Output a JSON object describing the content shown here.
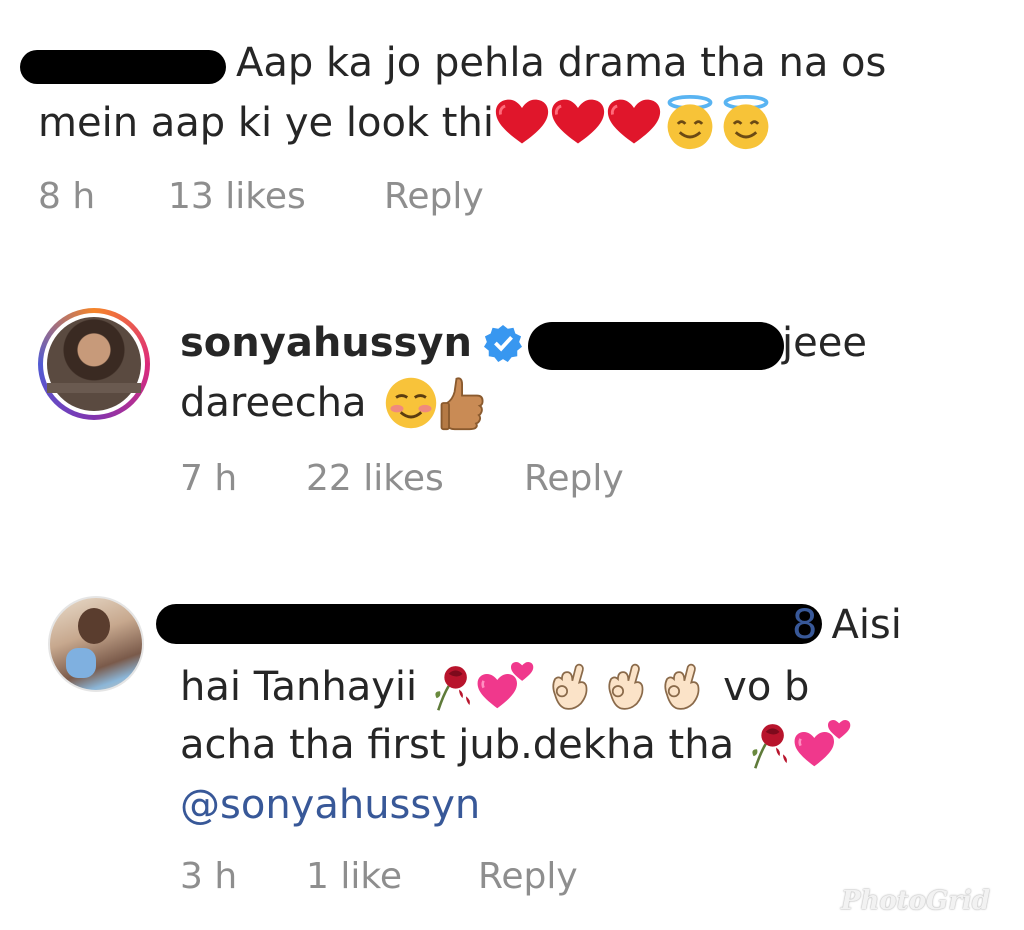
{
  "comments": [
    {
      "text_line1": "Aap ka jo pehla drama tha na os",
      "text_line2": "mein aap ki ye look thi",
      "emoji_icons": [
        "heart-icon",
        "heart-icon",
        "heart-icon",
        "smiling-halo-icon",
        "smiling-halo-icon"
      ],
      "time": "8 h",
      "likes": "13 likes",
      "reply": "Reply"
    },
    {
      "username": "sonyahussyn",
      "verified_icon": "verified-badge-icon",
      "text_suffix": "jeee",
      "text_line2": "dareecha",
      "emoji_icons": [
        "smiling-blush-icon",
        "thumbs-up-icon"
      ],
      "time": "7 h",
      "likes": "22 likes",
      "reply": "Reply"
    },
    {
      "username_tail": "8",
      "text_suffix": "Aisi",
      "text_line2": "hai Tanhayii",
      "text_line2b": "vo b",
      "text_line3": "acha tha first jub.dekha tha",
      "mention": "@sonyahussyn",
      "emoji_icons": [
        "wilted-rose-icon",
        "two-hearts-icon",
        "ok-hand-icon",
        "ok-hand-icon",
        "ok-hand-icon",
        "wilted-rose-icon",
        "two-hearts-icon"
      ],
      "time": "3 h",
      "likes": "1 like",
      "reply": "Reply"
    }
  ],
  "watermark": "PhotoGrid",
  "colors": {
    "text": "#262626",
    "meta": "#8e8e8e",
    "mention": "#385898",
    "verified": "#3897f0",
    "heart": "#e0162b"
  }
}
